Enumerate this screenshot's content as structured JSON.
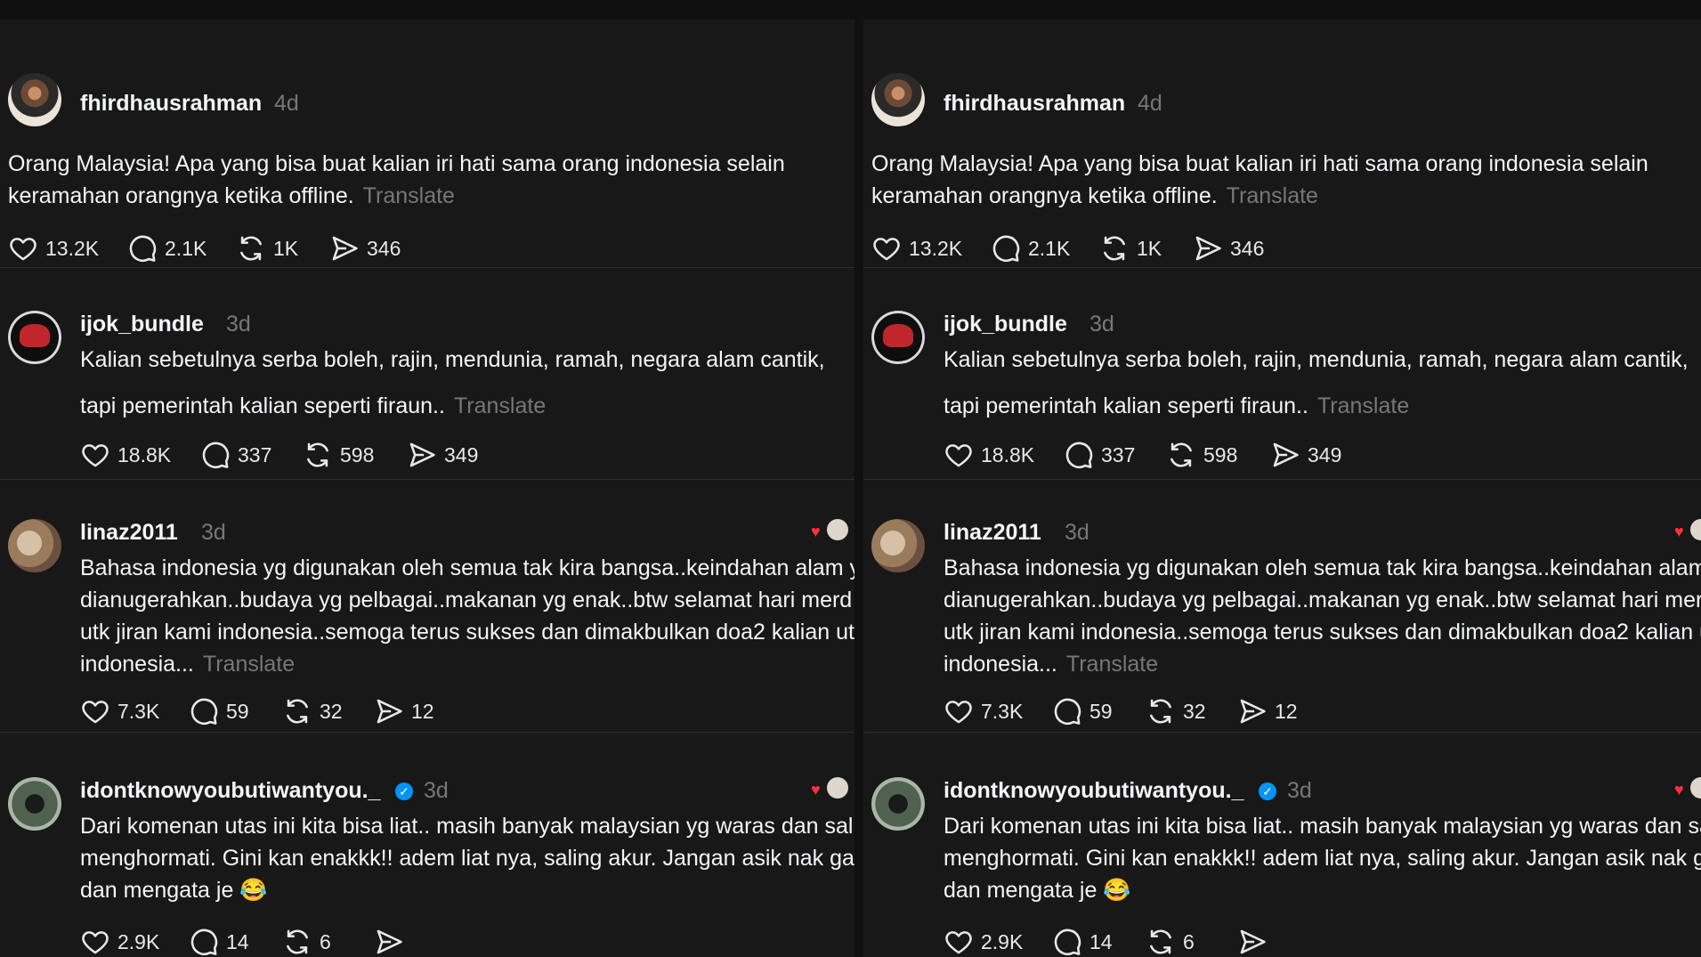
{
  "translate_label": "Translate",
  "posts": [
    {
      "username": "fhirdhausrahman",
      "time": "4d",
      "lines": [
        "Orang Malaysia! Apa yang bisa buat kalian iri hati sama orang indonesia selain",
        "keramahan orangnya ketika offline."
      ],
      "likes": "13.2K",
      "comments": "2.1K",
      "reposts": "1K",
      "shares": "346"
    },
    {
      "username": "ijok_bundle",
      "time": "3d",
      "lines": [
        "Kalian sebetulnya serba boleh, rajin, mendunia, ramah, negara alam cantik,",
        "tapi pemerintah kalian seperti firaun.."
      ],
      "likes": "18.8K",
      "comments": "337",
      "reposts": "598",
      "shares": "349"
    },
    {
      "username": "linaz2011",
      "time": "3d",
      "lines": [
        "Bahasa indonesia yg digunakan oleh semua tak kira bangsa..keindahan alam y",
        "dianugerahkan..budaya yg pelbagai..makanan yg enak..btw selamat hari merd",
        "utk jiran kami indonesia..semoga terus sukses dan dimakbulkan doa2 kalian ut",
        "indonesia..."
      ],
      "likes": "7.3K",
      "comments": "59",
      "reposts": "32",
      "shares": "12"
    },
    {
      "username": "idontknowyoubutiwantyou._",
      "verified": true,
      "time": "3d",
      "lines": [
        "Dari komenan utas ini kita bisa liat.. masih banyak malaysian yg waras dan sali",
        "menghormati. Gini kan enakkk!! adem liat nya, saling akur. Jangan asik nak ga",
        "dan mengata je 😂"
      ],
      "likes": "2.9K",
      "comments": "14",
      "reposts": "6",
      "shares": ""
    }
  ],
  "colors": {
    "background": "#181818",
    "text": "#f3f5f7",
    "muted": "#777777",
    "verified": "#0095f6",
    "heart": "#ff3040"
  },
  "icons": [
    "heart-icon",
    "comment-icon",
    "repost-icon",
    "share-icon",
    "verified-icon"
  ]
}
